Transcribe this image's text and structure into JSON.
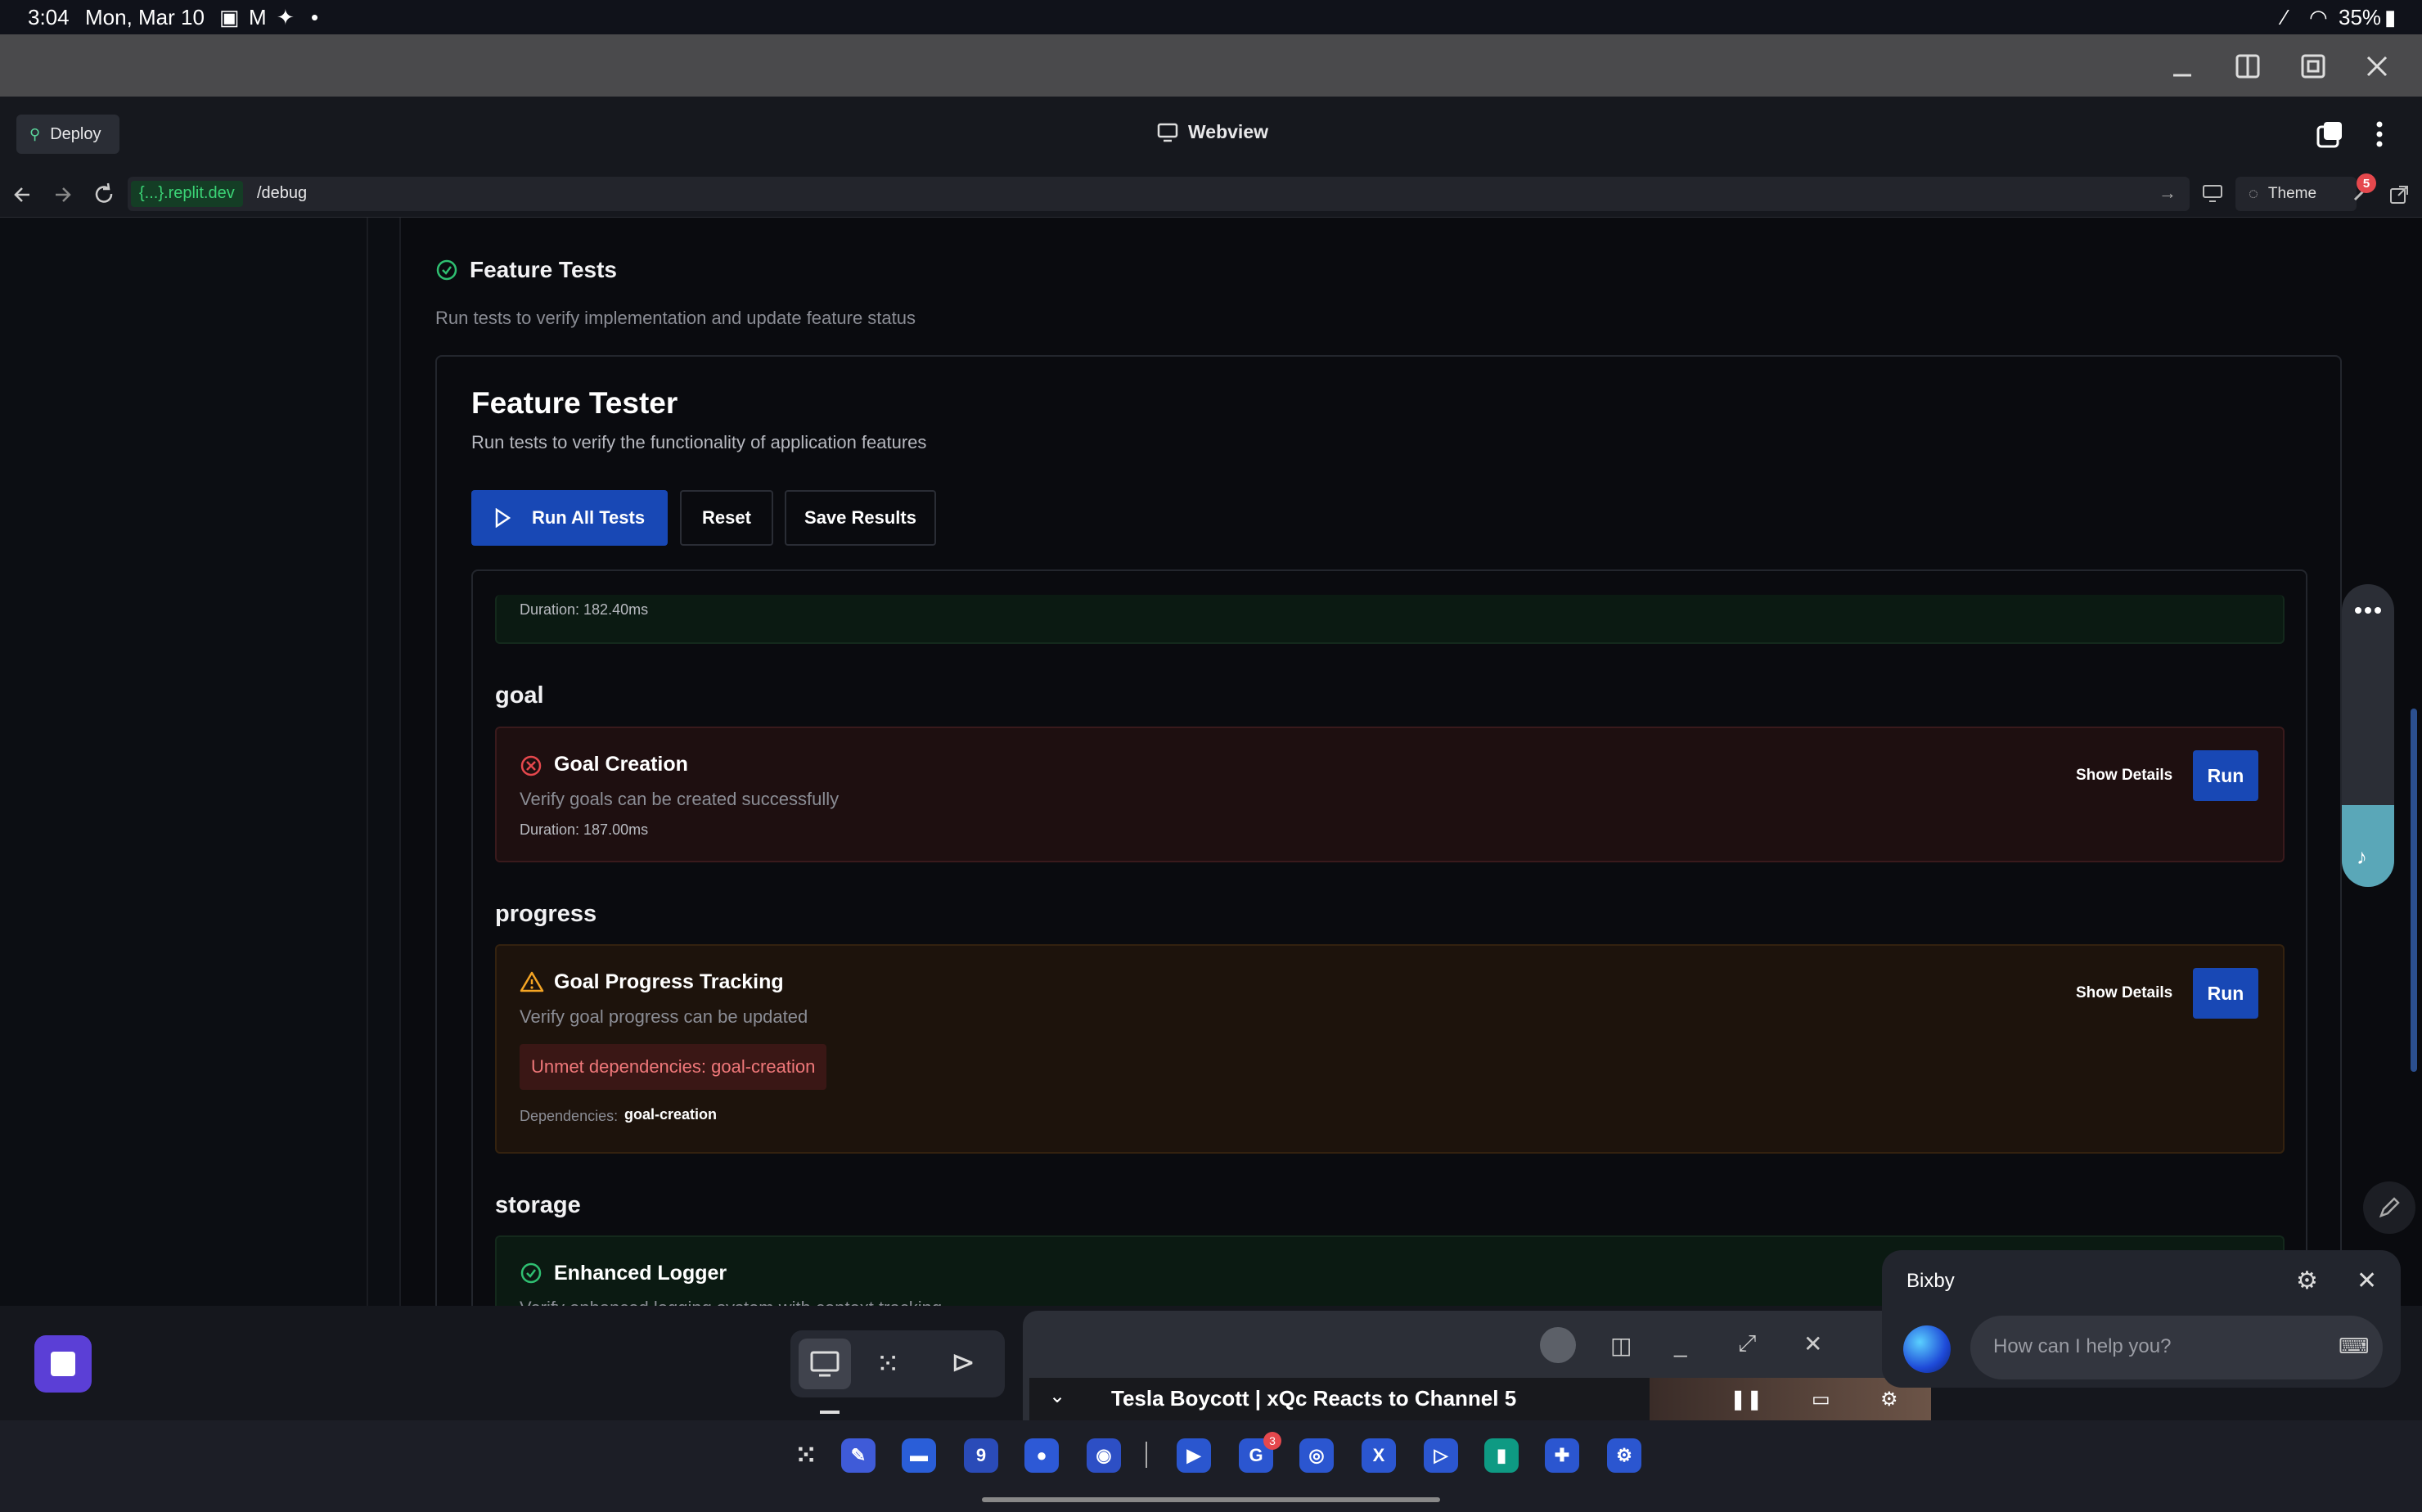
{
  "status_bar": {
    "time": "3:04",
    "date": "Mon, Mar 10",
    "battery": "35%"
  },
  "app_header": {
    "deploy_label": "Deploy",
    "webview_label": "Webview"
  },
  "url_bar": {
    "host": "{...}.replit.dev",
    "path": "/debug",
    "theme_label": "Theme",
    "notification_count": "5"
  },
  "section": {
    "title": "Feature Tests",
    "subtitle": "Run tests to verify implementation and update feature status"
  },
  "tester": {
    "title": "Feature Tester",
    "subtitle": "Run tests to verify the functionality of application features",
    "run_all_label": "Run All Tests",
    "reset_label": "Reset",
    "save_label": "Save Results",
    "prev_duration": "Duration: 182.40ms",
    "groups": [
      {
        "name": "goal",
        "test": {
          "title": "Goal Creation",
          "status": "failed",
          "description": "Verify goals can be created successfully",
          "duration": "Duration: 187.00ms",
          "show_details": "Show Details",
          "run": "Run"
        }
      },
      {
        "name": "progress",
        "test": {
          "title": "Goal Progress Tracking",
          "status": "warning",
          "description": "Verify goal progress can be updated",
          "unmet": "Unmet dependencies: goal-creation",
          "dependencies_label": "Dependencies:",
          "dependency": "goal-creation",
          "show_details": "Show Details",
          "run": "Run"
        }
      },
      {
        "name": "storage",
        "test": {
          "title": "Enhanced Logger",
          "status": "passed",
          "description": "Verify enhanced logging system with context tracking"
        }
      }
    ]
  },
  "bixby": {
    "title": "Bixby",
    "placeholder": "How can I help you?"
  },
  "video": {
    "title": "Tesla Boycott | xQc Reacts to Channel 5"
  },
  "dock": {
    "badge": "3"
  },
  "colors": {
    "accent": "#1848b5",
    "error": "#e5484d",
    "warning": "#f5a524",
    "success": "#2fbf71"
  }
}
